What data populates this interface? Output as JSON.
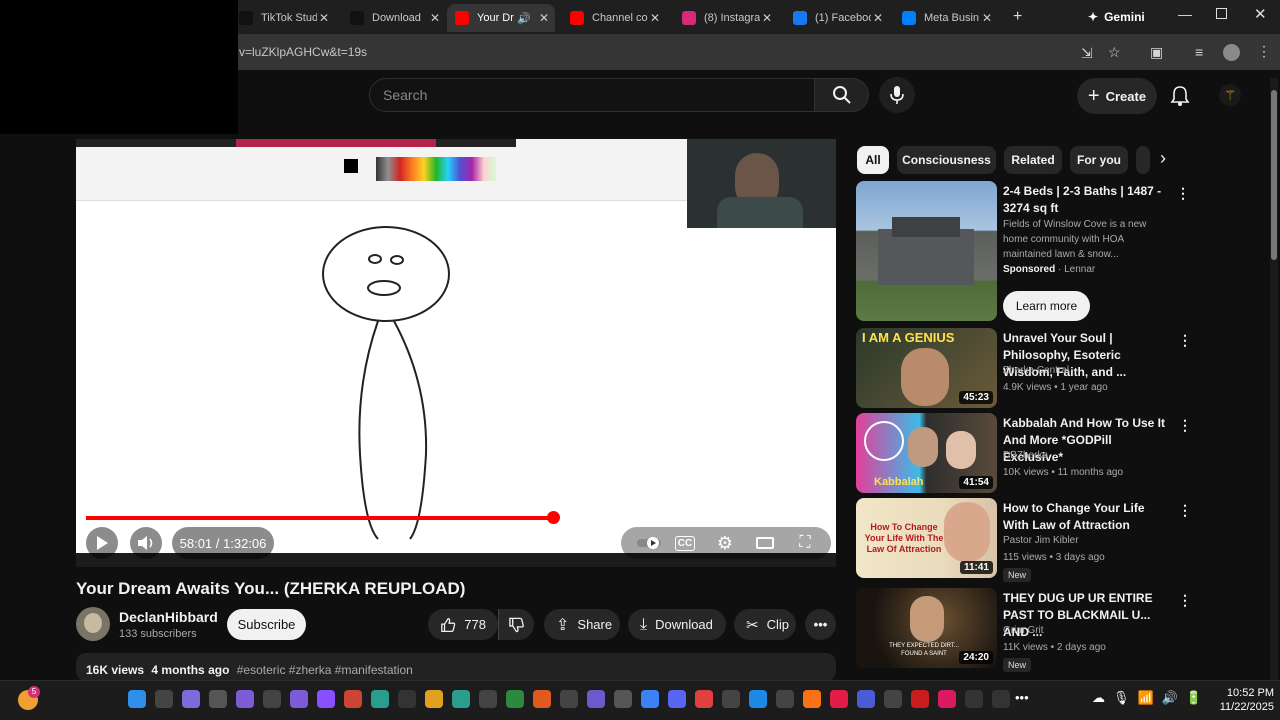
{
  "browser": {
    "tabs": [
      {
        "title": "TikTok Stud",
        "fav": "tiktok-icon",
        "color": "#111"
      },
      {
        "title": "Download",
        "fav": "tiktok-icon",
        "color": "#111"
      },
      {
        "title": "Your Dr",
        "fav": "youtube-icon",
        "color": "#ff0000"
      },
      {
        "title": "Channel co",
        "fav": "youtube-icon",
        "color": "#ff0000"
      },
      {
        "title": "(8) Instagra",
        "fav": "instagram-icon",
        "color": "#d62976"
      },
      {
        "title": "(1) Faceboo",
        "fav": "facebook-icon",
        "color": "#1877f2"
      },
      {
        "title": "Meta Busin",
        "fav": "meta-icon",
        "color": "#0081fb"
      }
    ],
    "gemini_label": "Gemini",
    "url": "v=luZKlpAGHCw&t=19s"
  },
  "header": {
    "search_placeholder": "Search",
    "create_label": "Create"
  },
  "player": {
    "time": "58:01 / 1:32:06",
    "progress": 0.63
  },
  "video": {
    "title": "Your Dream Awaits You... (ZHERKA REUPLOAD)",
    "channel": "DeclanHibbard",
    "subscribers": "133 subscribers",
    "subscribe_label": "Subscribe",
    "likes": "778",
    "share_label": "Share",
    "download_label": "Download",
    "clip_label": "Clip",
    "views": "16K views",
    "age": "4 months ago",
    "tags": "#esoteric #zherka #manifestation"
  },
  "chips": [
    "All",
    "Consciousness",
    "Related",
    "For you"
  ],
  "recommendations": [
    {
      "title": "2-4 Beds | 2-3 Baths | 1487 - 3274 sq ft",
      "desc": "Fields of Winslow Cove is a new home community with HOA maintained lawn & snow...",
      "sponsored": "Sponsored",
      "advertiser": "Lennar",
      "cta": "Learn more"
    },
    {
      "title": "Unravel Your Soul | Philosophy, Esoteric Wisdom, Faith, and ...",
      "channel": "Zherka Central",
      "meta": "4.9K views • 1 year ago",
      "duration": "45:23",
      "thumb_text": "I AM A GENIUS"
    },
    {
      "title": "Kabbalah And How To Use It And More *GODPill Exclusive*",
      "channel": "DBZherka",
      "meta": "10K views • 11 months ago",
      "duration": "41:54",
      "thumb_text": "Kabbalah"
    },
    {
      "title": "How to Change Your Life With Law of Attraction",
      "channel": "Pastor Jim Kibler",
      "meta": "115 views • 3 days ago",
      "duration": "11:41",
      "badge": "New",
      "thumb_text": "How To Change Your Life With The Law Of Attraction"
    },
    {
      "title": "THEY DUG UP UR ENTIRE PAST TO BLACKMAIL U... AND ...",
      "channel": "Grim Grit",
      "meta": "11K views • 2 days ago",
      "duration": "24:20",
      "badge": "New",
      "thumb_text": "THEY EXPECTED DIRT... FOUND A SAINT"
    }
  ],
  "taskbar": {
    "time": "10:52 PM",
    "date": "11/22/2025",
    "badge": "5"
  }
}
